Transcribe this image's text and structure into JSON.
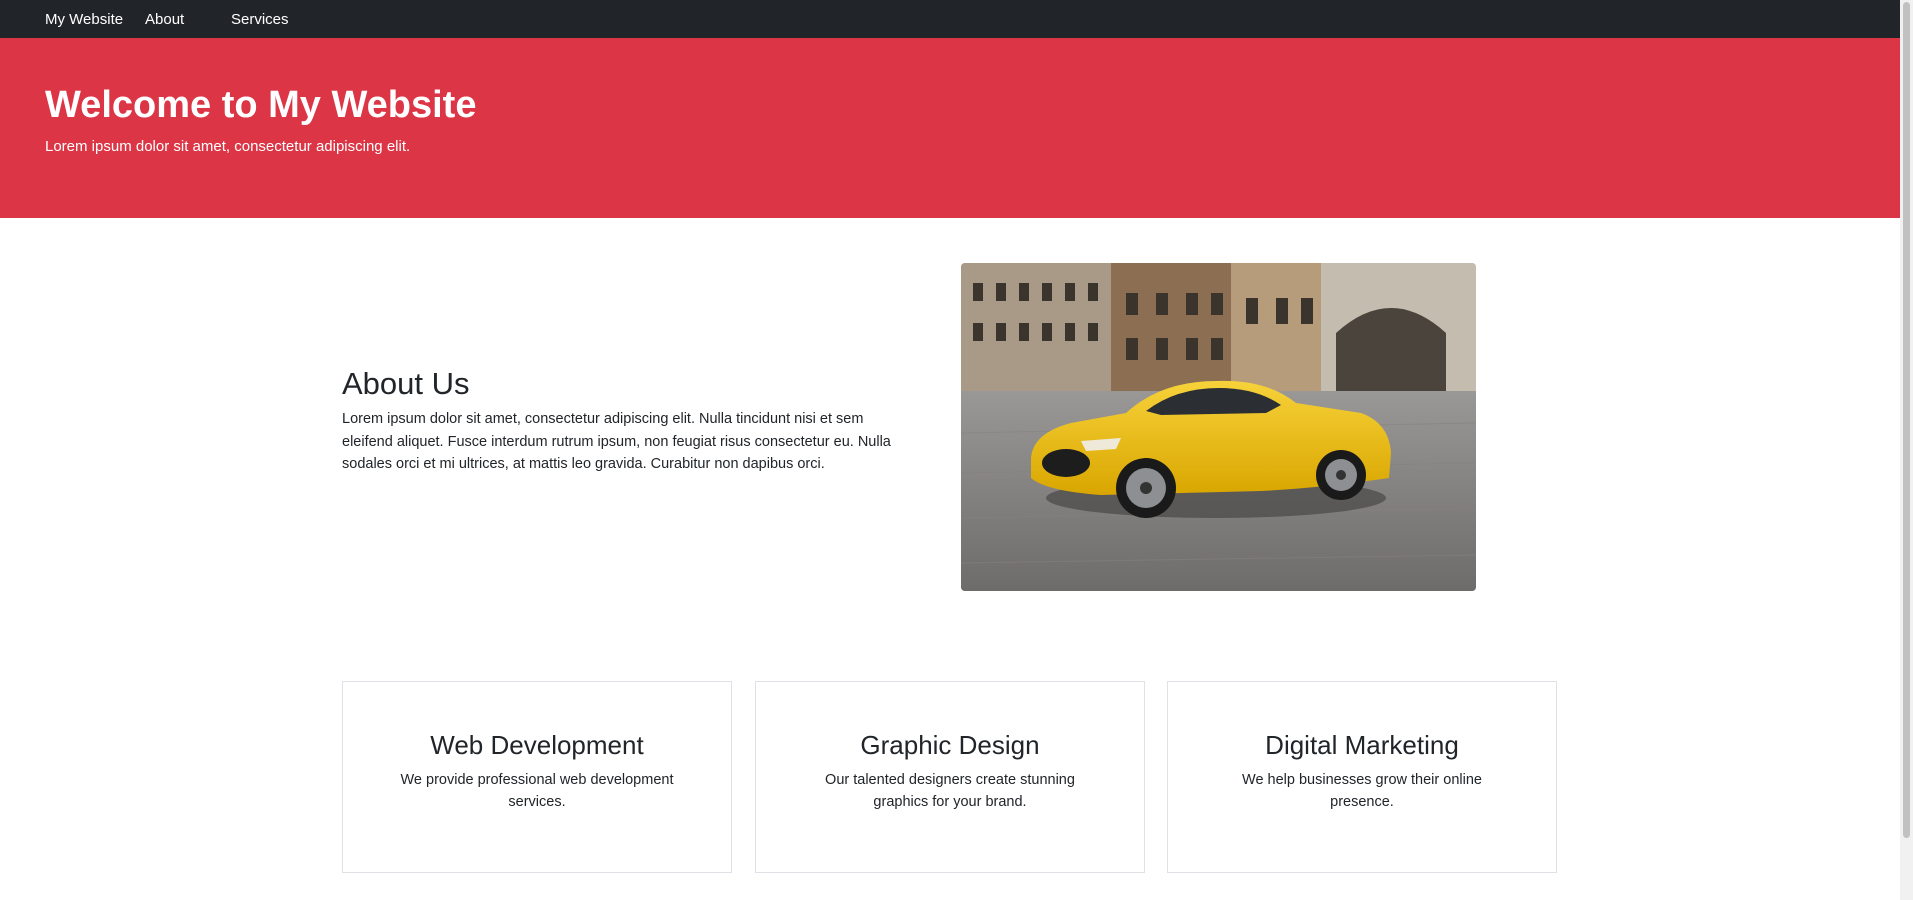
{
  "navbar": {
    "brand": "My Website",
    "links": [
      "About",
      "Services"
    ]
  },
  "hero": {
    "title": "Welcome to My Website",
    "subtitle": "Lorem ipsum dolor sit amet, consectetur adipiscing elit."
  },
  "about": {
    "title": "About Us",
    "text": "Lorem ipsum dolor sit amet, consectetur adipiscing elit. Nulla tincidunt nisi et sem eleifend aliquet. Fusce interdum rutrum ipsum, non feugiat risus consectetur eu. Nulla sodales orci et mi ultrices, at mattis leo gravida. Curabitur non dapibus orci.",
    "image": "yellow sports car in old town square"
  },
  "services": [
    {
      "title": "Web Development",
      "text": "We provide professional web development services."
    },
    {
      "title": "Graphic Design",
      "text": "Our talented designers create stunning graphics for your brand."
    },
    {
      "title": "Digital Marketing",
      "text": "We help businesses grow their online presence."
    }
  ],
  "colors": {
    "navbar": "#212529",
    "hero": "#dc3545",
    "text": "#212529"
  }
}
